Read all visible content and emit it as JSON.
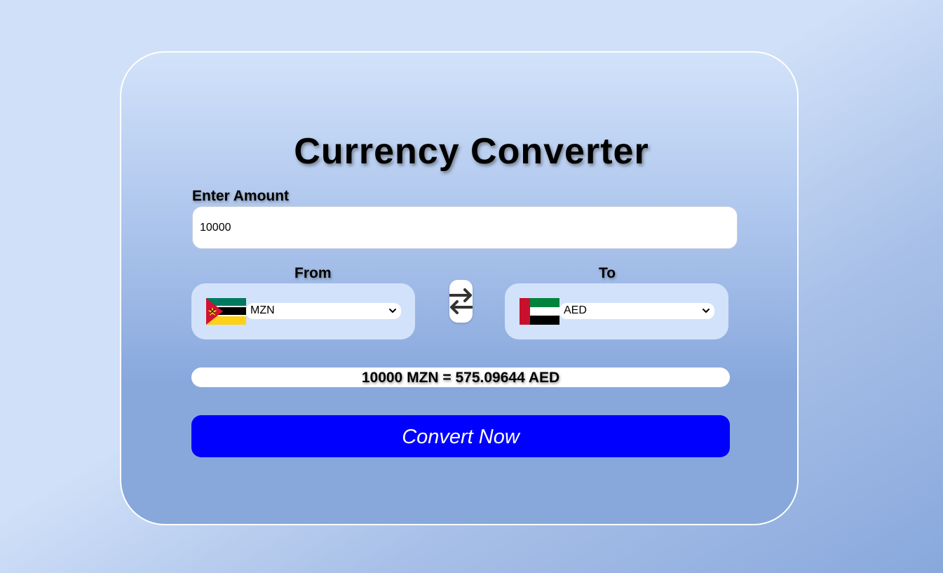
{
  "title": "Currency Converter",
  "amount": {
    "label": "Enter Amount",
    "value": "10000"
  },
  "from": {
    "label": "From",
    "currency": "MZN",
    "flag": "mozambique-flag"
  },
  "to": {
    "label": "To",
    "currency": "AED",
    "flag": "uae-flag"
  },
  "swap_icon": "swap-arrows-icon",
  "result": "10000 MZN = 575.09644 AED",
  "convert_button": "Convert Now",
  "colors": {
    "button": "#0000ff",
    "card_border": "#ffffff"
  }
}
